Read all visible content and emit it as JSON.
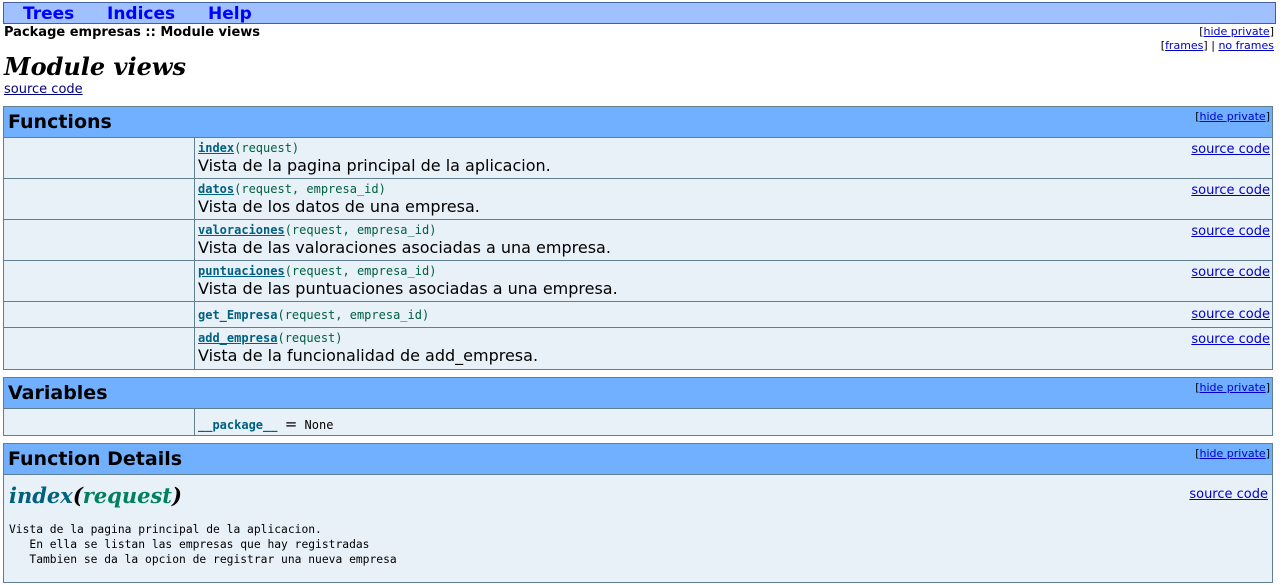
{
  "nav": {
    "trees": "Trees",
    "indices": "Indices",
    "help": "Help"
  },
  "breadcrumb": "Package empresas :: Module views",
  "top_links": {
    "hide_private": "hide private",
    "frames": "frames",
    "separator": "|",
    "no_frames": "no frames"
  },
  "page_title": "Module views",
  "source_code": "source code",
  "functions": {
    "title": "Functions",
    "hide_private": "hide private",
    "items": [
      {
        "name": "index",
        "params": "(request)",
        "desc": "Vista de la pagina principal de la aplicacion.",
        "src": "source code"
      },
      {
        "name": "datos",
        "params": "(request, empresa_id)",
        "desc": "Vista de los datos de una empresa.",
        "src": "source code"
      },
      {
        "name": "valoraciones",
        "params": "(request, empresa_id)",
        "desc": "Vista de las valoraciones asociadas a una empresa.",
        "src": "source code"
      },
      {
        "name": "puntuaciones",
        "params": "(request, empresa_id)",
        "desc": "Vista de las puntuaciones asociadas a una empresa.",
        "src": "source code"
      },
      {
        "name": "get_Empresa",
        "params": "(request, empresa_id)",
        "desc": "",
        "src": "source code"
      },
      {
        "name": "add_empresa",
        "params": "(request)",
        "desc": "Vista de la funcionalidad de add_empresa.",
        "src": "source code"
      }
    ]
  },
  "variables": {
    "title": "Variables",
    "hide_private": "hide private",
    "items": [
      {
        "name": "__package__",
        "eq": "=",
        "value": "None"
      }
    ]
  },
  "details": {
    "title": "Function Details",
    "hide_private": "hide private",
    "func_name": "index",
    "open_paren": "(",
    "param": "request",
    "close_paren": ")",
    "src": "source code",
    "doc": "Vista de la pagina principal de la aplicacion.\n   En ella se listan las empresas que hay registradas\n   Tambien se da la opcion de registrar una nueva empresa"
  }
}
